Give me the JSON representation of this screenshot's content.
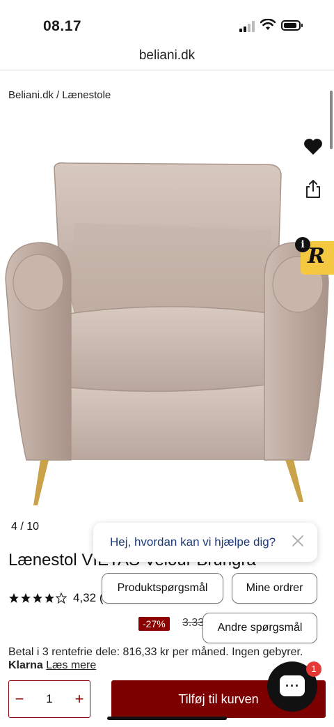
{
  "status": {
    "time": "08.17"
  },
  "browser": {
    "url": "beliani.dk"
  },
  "breadcrumb": [
    "Beliani.dk",
    "/",
    "Lænestole"
  ],
  "gallery": {
    "counter": "4 / 10"
  },
  "product": {
    "title": "Lænestol VIETAS Velour Brungrå",
    "rating_value": "4,32",
    "rating_extra": "(",
    "stars": 4,
    "discount": "-27%",
    "old_price": "3.33",
    "installments_text": "Betal i 3 rentefrie dele: 816,33 kr per måned. Ingen gebyrer.",
    "klarna": "Klarna",
    "read_more": "Læs mere"
  },
  "cart": {
    "quantity": "1",
    "minus": "−",
    "plus": "+",
    "add_label": "Tilføj til kurven"
  },
  "chat": {
    "greeting": "Hej, hvordan kan vi hjælpe dig?",
    "options": [
      "Produktspørgsmål",
      "Mine ordrer",
      "Andre spørgsmål"
    ],
    "unread": "1"
  },
  "colors": {
    "brand": "#7d0000",
    "badge": "#f5c842",
    "chat_text": "#1f3a7a"
  },
  "icons": [
    "heart-icon",
    "share-icon",
    "close-icon",
    "chat-icon",
    "star-icon"
  ]
}
